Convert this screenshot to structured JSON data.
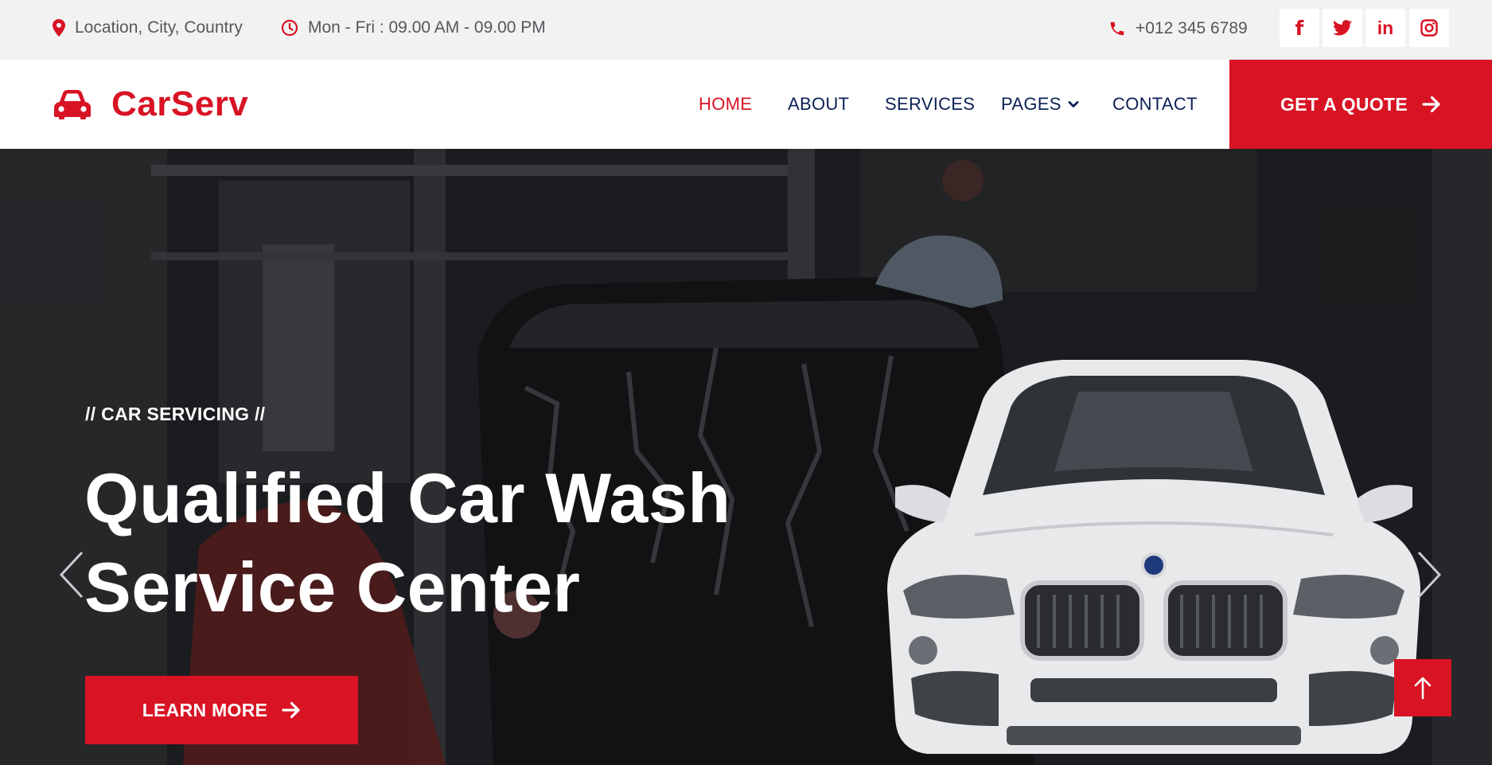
{
  "topbar": {
    "location": "Location, City, Country",
    "hours": "Mon - Fri : 09.00 AM - 09.00 PM",
    "phone": "+012 345 6789",
    "social": [
      {
        "icon": "facebook-icon",
        "glyph": "f"
      },
      {
        "icon": "twitter-icon",
        "glyph": ""
      },
      {
        "icon": "linkedin-icon",
        "glyph": "in"
      },
      {
        "icon": "instagram-icon",
        "glyph": ""
      }
    ]
  },
  "navbar": {
    "brand": "CarServ",
    "links": [
      "HOME",
      "ABOUT",
      "SERVICES",
      "PAGES",
      "CONTACT"
    ],
    "active": "HOME",
    "cta": "GET A QUOTE"
  },
  "hero": {
    "eyebrow": "// CAR SERVICING //",
    "headline_line1": "Qualified Car Wash",
    "headline_line2": "Service Center",
    "button": "LEARN MORE"
  },
  "colors": {
    "accent": "#d81324",
    "navy": "#0b2154",
    "topbar_bg": "#f2f2f2"
  }
}
